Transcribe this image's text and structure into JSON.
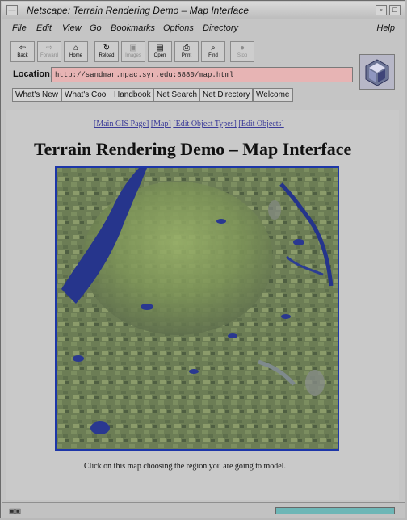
{
  "window": {
    "title": "Netscape: Terrain Rendering Demo – Map Interface"
  },
  "menubar": {
    "items": [
      "File",
      "Edit",
      "View",
      "Go",
      "Bookmarks",
      "Options",
      "Directory",
      "Help"
    ]
  },
  "toolbar": {
    "buttons": [
      {
        "label": "Back",
        "icon": "back-arrow-icon",
        "enabled": true
      },
      {
        "label": "Forward",
        "icon": "forward-arrow-icon",
        "enabled": false
      },
      {
        "label": "Home",
        "icon": "home-icon",
        "enabled": true
      },
      {
        "label": "Reload",
        "icon": "reload-icon",
        "enabled": true
      },
      {
        "label": "Images",
        "icon": "images-icon",
        "enabled": false
      },
      {
        "label": "Open",
        "icon": "open-icon",
        "enabled": true
      },
      {
        "label": "Print",
        "icon": "print-icon",
        "enabled": true
      },
      {
        "label": "Find",
        "icon": "find-icon",
        "enabled": true
      },
      {
        "label": "Stop",
        "icon": "stop-icon",
        "enabled": false
      }
    ]
  },
  "location": {
    "label": "Location:",
    "url": "http://sandman.npac.syr.edu:8880/map.html"
  },
  "directory_buttons": [
    "What's New",
    "What's Cool",
    "Handbook",
    "Net Search",
    "Net Directory",
    "Welcome"
  ],
  "content": {
    "links": [
      "[Main GIS Page]",
      "[Map]",
      "[Edit Object Types]",
      "[Edit Objects]"
    ],
    "heading": "Terrain Rendering Demo – Map Interface",
    "caption": "Click on this map choosing the region you are going to model."
  },
  "status": {
    "progress_fraction": 1.0
  },
  "colors": {
    "window_bg": "#c5c5c5",
    "link": "#3a3a98",
    "location_field_bg": "#e7b4b4",
    "map_border": "#1d36a8"
  }
}
